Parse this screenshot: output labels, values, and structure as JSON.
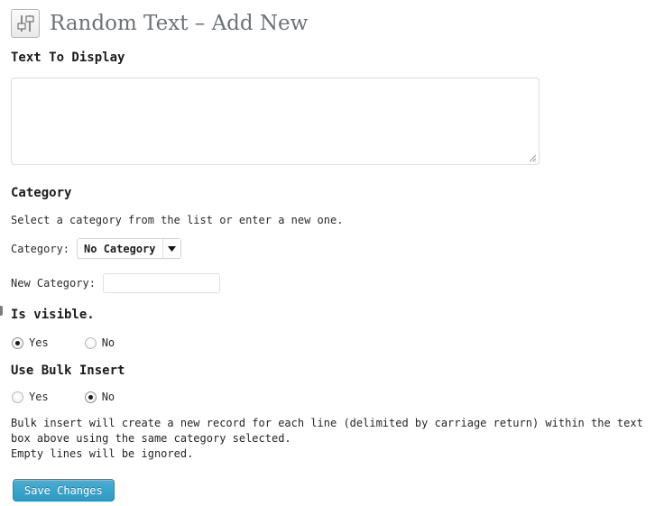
{
  "header": {
    "icon": "sliders-settings-icon",
    "title": "Random Text – Add New"
  },
  "form": {
    "text_to_display": {
      "label": "Text To Display",
      "value": "",
      "placeholder": ""
    },
    "category_section": {
      "heading": "Category",
      "helper": "Select a category from the list or enter a new one.",
      "category_field": {
        "label": "Category:",
        "selected": "No Category",
        "options": [
          "No Category"
        ]
      },
      "new_category_field": {
        "label": "New Category:",
        "value": "",
        "placeholder": ""
      }
    },
    "visible_section": {
      "heading": "Is visible.",
      "options": [
        {
          "label": "Yes",
          "checked": true
        },
        {
          "label": "No",
          "checked": false
        }
      ]
    },
    "bulk_insert_section": {
      "heading": "Use Bulk Insert",
      "options": [
        {
          "label": "Yes",
          "checked": false
        },
        {
          "label": "No",
          "checked": true
        }
      ],
      "note_line_1": "Bulk insert will create a new record for each line (delimited by carriage return) within the text box above using the same category selected.",
      "note_line_2": "Empty lines will be ignored."
    },
    "submit": {
      "label": "Save Changes"
    }
  },
  "colors": {
    "accent_button": "#2e9ac4",
    "accent_button_light": "#49aed3",
    "title_text": "#6c7377",
    "body_text": "#222222",
    "border_light": "#dcdcdc"
  }
}
